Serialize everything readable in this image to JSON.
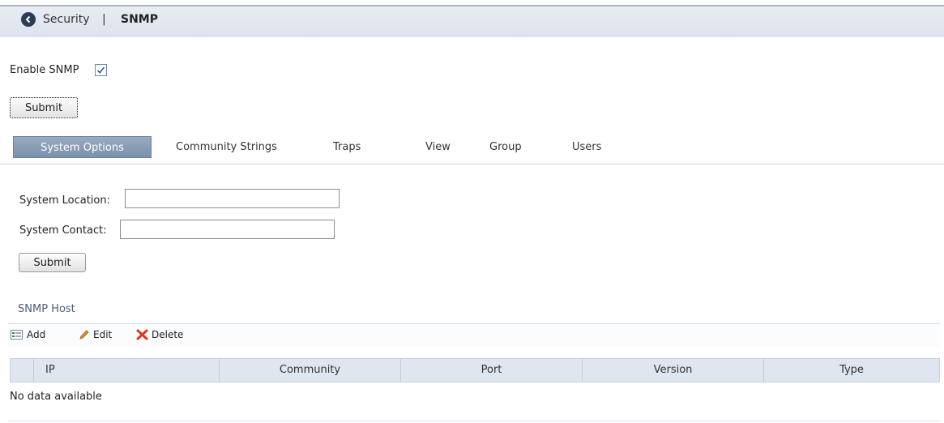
{
  "breadcrumb": {
    "parent": "Security",
    "separator": "|",
    "current": "SNMP"
  },
  "enable": {
    "label": "Enable SNMP",
    "checked": true
  },
  "submit_top": "Submit",
  "tabs": [
    {
      "label": "System Options",
      "active": true
    },
    {
      "label": "Community Strings",
      "active": false
    },
    {
      "label": "Traps",
      "active": false
    },
    {
      "label": "View",
      "active": false
    },
    {
      "label": "Group",
      "active": false
    },
    {
      "label": "Users",
      "active": false
    }
  ],
  "system_options": {
    "location_label": "System Location:",
    "location_value": "",
    "contact_label": "System Contact:",
    "contact_value": "",
    "submit_label": "Submit"
  },
  "snmp_host": {
    "title": "SNMP Host",
    "toolbar": {
      "add": "Add",
      "edit": "Edit",
      "delete": "Delete"
    },
    "columns": [
      "IP",
      "Community",
      "Port",
      "Version",
      "Type"
    ],
    "empty_text": "No data available"
  },
  "colors": {
    "accent": "#7b90ab",
    "header_bg": "#dde3ec",
    "grid_header": "#dfe6f0",
    "section_title": "#4a5f7c"
  },
  "icons": [
    "back-icon",
    "checkmark-icon",
    "add-icon",
    "edit-pencil-icon",
    "delete-x-icon"
  ]
}
